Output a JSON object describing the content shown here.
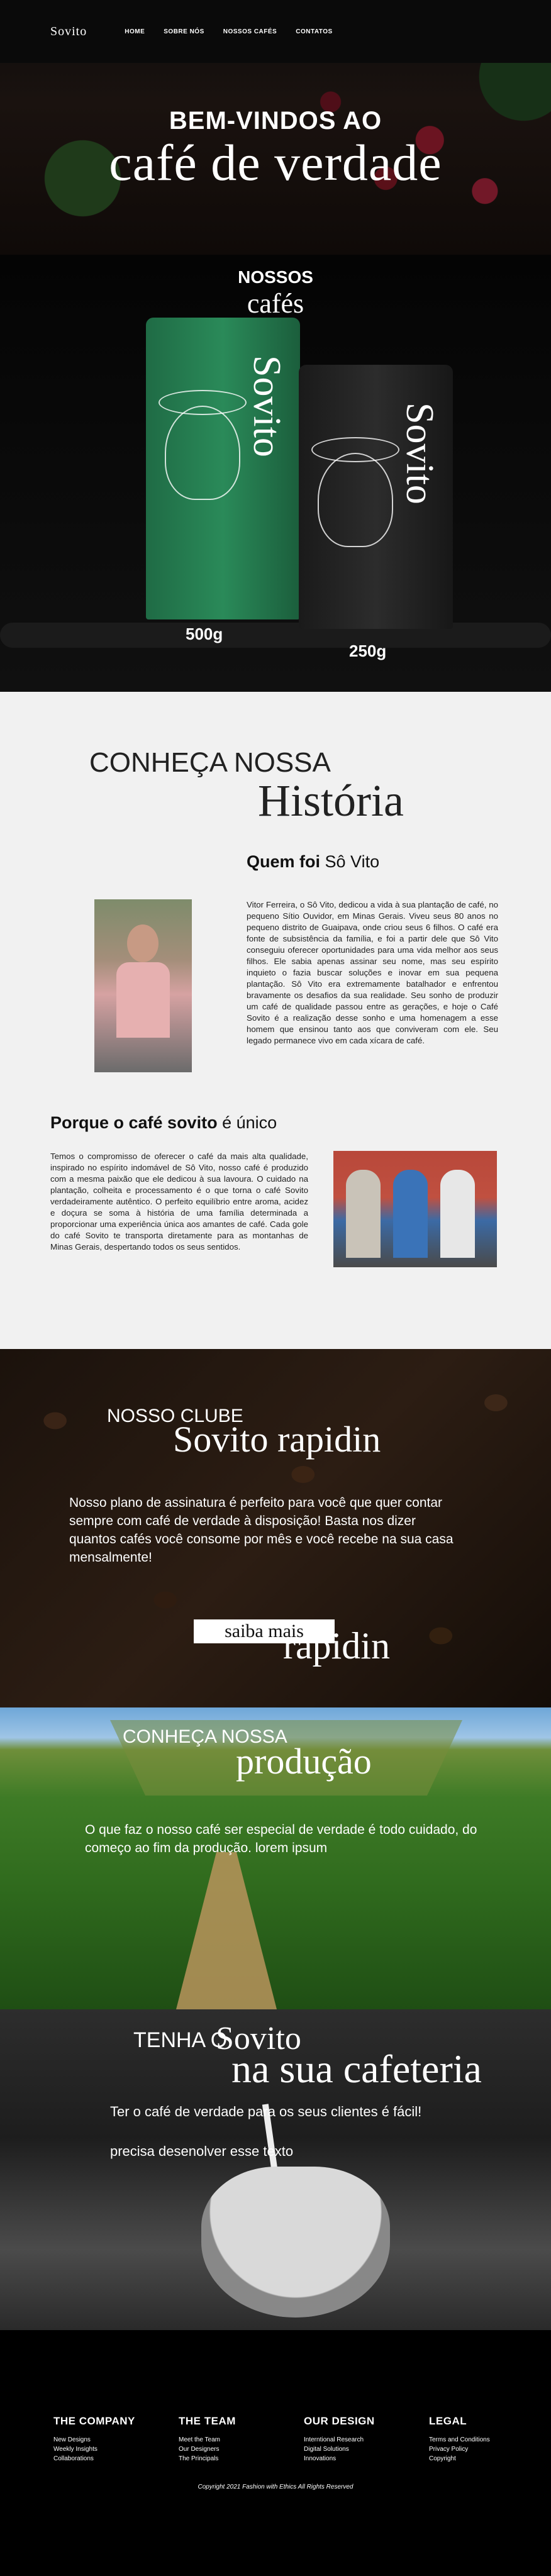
{
  "nav": {
    "logo": "Sovito",
    "links": [
      "HOME",
      "SOBRE NÓS",
      "NOSSOS CAFÉS",
      "CONTATOS"
    ]
  },
  "hero": {
    "title_top": "BEM-VINDOS AO",
    "title_main": "café de verdade"
  },
  "cafes": {
    "title_top": "NOSSOS",
    "title_main": "cafés",
    "bags": [
      {
        "brand": "Sovito",
        "weight": "500g",
        "color": "#2a8a59"
      },
      {
        "brand": "Sovito",
        "weight": "250g",
        "color": "#2c2c2c"
      }
    ]
  },
  "historia": {
    "title_top": "CONHEÇA NOSSA",
    "title_main": "História",
    "quem_bold": "Quem foi",
    "quem_rest": "Sô Vito",
    "bio": "Vitor Ferreira, o Sô Vito, dedicou a vida à sua plantação de café, no pequeno Sítio Ouvidor, em Minas Gerais. Viveu seus 80 anos no pequeno distrito de Guaipava, onde criou seus 6 filhos. O café era fonte de subsistência da família, e foi a partir dele que Sô Vito conseguiu oferecer oportunidades para uma vida melhor aos seus filhos. Ele sabia apenas assinar seu nome, mas seu espírito inquieto o fazia buscar soluções e inovar em sua pequena plantação. Sô Vito era extremamente batalhador e enfrentou bravamente os desafios da sua realidade. Seu sonho de produzir um café de qualidade passou entre as gerações, e hoje o Café Sovito é a realização desse sonho e uma homenagem a esse homem que ensinou tanto aos que conviveram com ele. Seu legado permanece vivo em cada xícara de café.",
    "porque_bold": "Porque o café sovito",
    "porque_rest": "é único",
    "porque_text": "Temos o compromisso de oferecer o café da mais alta qualidade, inspirado no espírito indomável de Sô Vito, nosso café é produzido com a mesma paixão que ele dedicou à sua lavoura. O cuidado na plantação, colheita e processamento é o que torna o café Sovito verdadeiramente autêntico. O perfeito equilíbrio entre aroma, acidez e doçura se soma à história de uma família determinada a proporcionar uma experiência única aos amantes de café. Cada gole do café Sovito te transporta diretamente para as montanhas de Minas Gerais, despertando todos os seus sentidos."
  },
  "clube": {
    "title_top": "NOSSO CLUBE",
    "title_main": "Sovito rapidin",
    "body": "Nosso plano de assinatura é perfeito para você que quer contar sempre com café de verdade à disposição! Basta nos dizer quantos cafés você consome por mês e você recebe na sua casa mensalmente!",
    "button": "saiba mais",
    "ghost": "rapidin"
  },
  "producao": {
    "title_top": "CONHEÇA NOSSA",
    "title_main": "produção",
    "body": "O que faz o nosso café ser especial de verdade é todo cuidado, do começo ao fim da produção. lorem ipsum"
  },
  "cafeteria": {
    "title_top": "TENHA O",
    "title_brand": "Sovito",
    "title_main": "na sua cafeteria",
    "p1": "Ter o café de verdade para os seus clientes é fácil!",
    "p2": "precisa desenolver esse texto"
  },
  "footer": {
    "columns": [
      {
        "title": "THE COMPANY",
        "links": [
          "New Designs",
          "Weekly Insights",
          "Collaborations"
        ]
      },
      {
        "title": "THE TEAM",
        "links": [
          "Meet the Team",
          "Our Designers",
          "The Principals"
        ]
      },
      {
        "title": "OUR DESIGN",
        "links": [
          "Interntional Research",
          "Digital Solutions",
          "Innovations"
        ]
      },
      {
        "title": "LEGAL",
        "links": [
          "Terms and Conditions",
          "Privacy Policy",
          "Copyright"
        ]
      }
    ],
    "copyright": "Copyright 2021 Fashion with Ethics All Rights Reserved"
  }
}
